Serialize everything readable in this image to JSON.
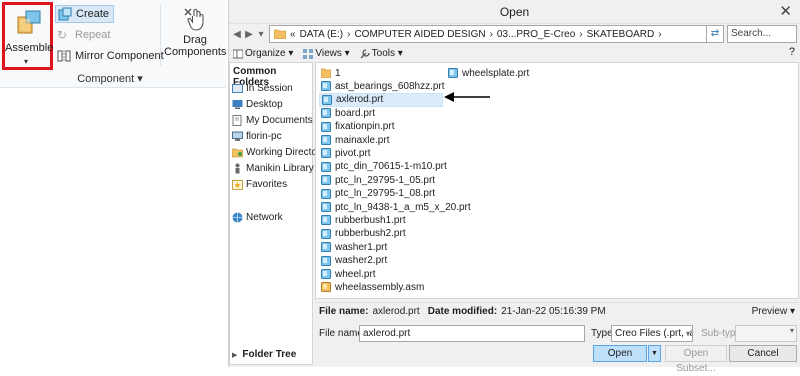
{
  "ribbon": {
    "assemble_label": "Assemble",
    "create_label": "Create",
    "repeat_label": "Repeat",
    "mirror_label": "Mirror Component",
    "drag_label_1": "Drag",
    "drag_label_2": "Components",
    "group_label": "Component ▾"
  },
  "dialog": {
    "title": "Open",
    "address": [
      "«",
      "DATA (E:)",
      "›",
      "COMPUTER AIDED DESIGN",
      "›",
      "03...PRO_E-Creo",
      "›",
      "SKATEBOARD",
      "›"
    ],
    "search_placeholder": "Search...",
    "toolbar": {
      "organize": "Organize ▾",
      "views": "Views ▾",
      "tools": "Tools ▾",
      "help": "?"
    },
    "common_folders": {
      "header": "Common Folders",
      "items": [
        "In Session",
        "Desktop",
        "My Documents",
        "florin-pc",
        "Working Directory",
        "Manikin Library",
        "Favorites",
        "Network"
      ]
    },
    "folder_tree_label": "Folder Tree",
    "files_col1": [
      "1",
      "ast_bearings_608hzz.prt",
      "axlerod.prt",
      "board.prt",
      "fixationpin.prt",
      "mainaxle.prt",
      "pivot.prt",
      "ptc_din_70615-1-m10.prt",
      "ptc_ln_29795-1_05.prt",
      "ptc_ln_29795-1_08.prt",
      "ptc_ln_9438-1_a_m5_x_20.prt",
      "rubberbush1.prt",
      "rubberbush2.prt",
      "washer1.prt",
      "washer2.prt",
      "wheel.prt",
      "wheelassembly.asm"
    ],
    "files_col2": [
      "wheelsplate.prt"
    ],
    "selected_file_index": 2,
    "info": {
      "file_name_label": "File name:",
      "file_name_value": "axlerod.prt",
      "date_label": "Date modified:",
      "date_value": "21-Jan-22 05:16:39 PM",
      "preview_label": "Preview ▾"
    },
    "filename_field": {
      "label": "File name",
      "value": "axlerod.prt"
    },
    "type_field": {
      "label": "Type",
      "value": "Creo Files (.prt, .asm,"
    },
    "subtype_label": "Sub-type",
    "buttons": {
      "open": "Open",
      "open_subset": "Open Subset...",
      "cancel": "Cancel"
    }
  },
  "colors": {
    "highlight_border": "#e0141e",
    "selection_bg": "#dcebfb",
    "primary_button": "#bfe0fb"
  }
}
